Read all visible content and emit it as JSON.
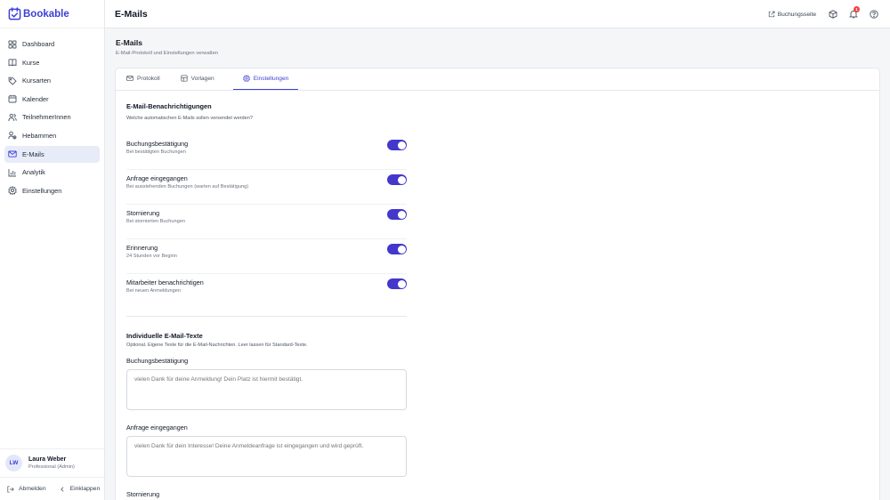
{
  "app": {
    "name": "Bookable"
  },
  "sidebar": {
    "items": [
      {
        "label": "Dashboard",
        "icon": "dashboard-icon"
      },
      {
        "label": "Kurse",
        "icon": "book-icon"
      },
      {
        "label": "Kursarten",
        "icon": "tag-icon"
      },
      {
        "label": "Kalender",
        "icon": "calendar-icon"
      },
      {
        "label": "TeilnehmerInnen",
        "icon": "users-icon"
      },
      {
        "label": "Hebammen",
        "icon": "user-group-icon"
      },
      {
        "label": "E-Mails",
        "icon": "mail-icon",
        "active": true
      },
      {
        "label": "Analytik",
        "icon": "chart-icon"
      },
      {
        "label": "Einstellungen",
        "icon": "settings-icon"
      }
    ],
    "user": {
      "initials": "LW",
      "name": "Laura Weber",
      "role": "Professional (Admin)"
    },
    "logout_label": "Abmelden",
    "collapse_label": "Einklappen"
  },
  "topbar": {
    "title": "E-Mails",
    "booking_page_label": "Buchungsseite",
    "notification_count": "1"
  },
  "page": {
    "title": "E-Mails",
    "subtitle": "E-Mail-Protokoll und Einstellungen verwalten"
  },
  "tabs": [
    {
      "label": "Protokoll",
      "icon": "mail-icon"
    },
    {
      "label": "Vorlagen",
      "icon": "template-icon"
    },
    {
      "label": "Einstellungen",
      "icon": "gear-icon",
      "active": true
    }
  ],
  "notifications": {
    "title": "E-Mail-Benachrichtigungen",
    "description": "Welche automatischen E-Mails sollen versendet werden?",
    "items": [
      {
        "title": "Buchungsbestätigung",
        "description": "Bei bestätigten Buchungen",
        "enabled": true
      },
      {
        "title": "Anfrage eingegangen",
        "description": "Bei ausstehenden Buchungen (warten auf Bestätigung)",
        "enabled": true
      },
      {
        "title": "Stornierung",
        "description": "Bei stornierten Buchungen",
        "enabled": true
      },
      {
        "title": "Erinnerung",
        "description": "24 Stunden vor Beginn",
        "enabled": true
      },
      {
        "title": "Mitarbeiter benachrichtigen",
        "description": "Bei neuen Anmeldungen",
        "enabled": true
      }
    ]
  },
  "custom_texts": {
    "title": "Individuelle E-Mail-Texte",
    "description": "Optional. Eigene Texte für die E-Mail-Nachrichten. Leer lassen für Standard-Texte.",
    "fields": [
      {
        "label": "Buchungsbestätigung",
        "placeholder": "vielen Dank für deine Anmeldung! Dein Platz ist hiermit bestätigt."
      },
      {
        "label": "Anfrage eingegangen",
        "placeholder": "vielen Dank für dein Interesse! Deine Anmeldeanfrage ist eingegangen und wird geprüft."
      },
      {
        "label": "Stornierung",
        "placeholder": ""
      }
    ]
  },
  "colors": {
    "accent": "#3b3fd6",
    "toggle_on": "#4338ca",
    "badge": "#ef4444"
  }
}
